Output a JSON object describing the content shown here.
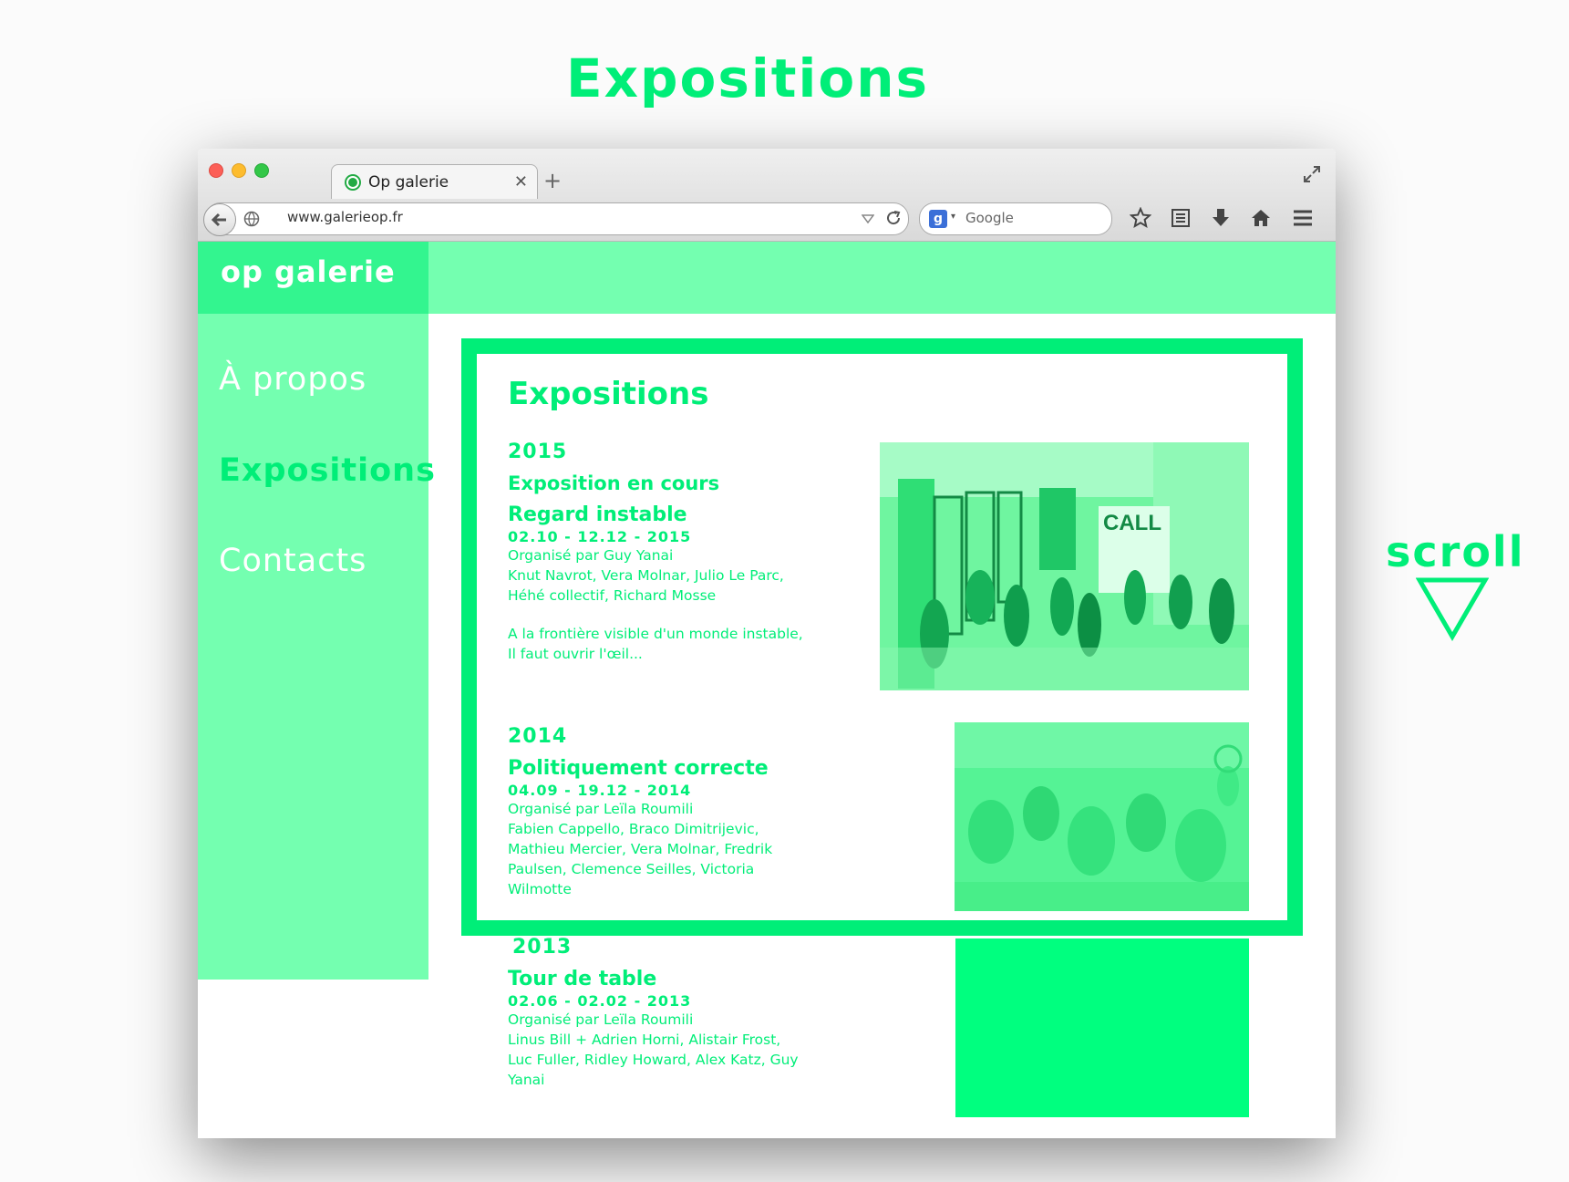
{
  "headline": "Expositions",
  "scroll_hint": "scroll",
  "browser": {
    "tab_title": "Op galerie",
    "url": "www.galerieop.fr",
    "search_placeholder": "Google"
  },
  "site": {
    "logo": "op galerie",
    "nav": [
      {
        "label": "À propos",
        "active": false
      },
      {
        "label": "Expositions",
        "active": true
      },
      {
        "label": "Contacts",
        "active": false
      }
    ],
    "content_title": "Expositions",
    "exhibitions": [
      {
        "year": "2015",
        "status": "Exposition en cours",
        "title": "Regard instable",
        "dates": "02.10 - 12.12 - 2015",
        "organizer": "Organisé par Guy Yanai",
        "artists": "Knut Navrot, Vera Molnar, Julio Le Parc, Héhé collectif, Richard Mosse",
        "quote": [
          "A la frontière visible d'un monde instable,",
          "Il faut ouvrir l'œil..."
        ],
        "photo_text": "CALL"
      },
      {
        "year": "2014",
        "title": "Politiquement correcte",
        "dates": "04.09 - 19.12 - 2014",
        "organizer": "Organisé par Leïla Roumili",
        "artists": "Fabien Cappello, Braco Dimitrijevic, Mathieu Mercier, Vera Molnar, Fredrik Paulsen,  Clemence Seilles, Victoria Wilmotte"
      },
      {
        "year": "2013",
        "title": "Tour de table",
        "dates": "02.06 - 02.02 - 2013",
        "organizer": "Organisé par Leïla Roumili",
        "artists": "Linus Bill + Adrien Horni, Alistair Frost, Luc Fuller, Ridley Howard, Alex Katz, Guy Yanai"
      }
    ]
  },
  "colors": {
    "accent": "#00ee78",
    "light_green": "#74ffb0",
    "logo_bg": "#33f58f"
  }
}
